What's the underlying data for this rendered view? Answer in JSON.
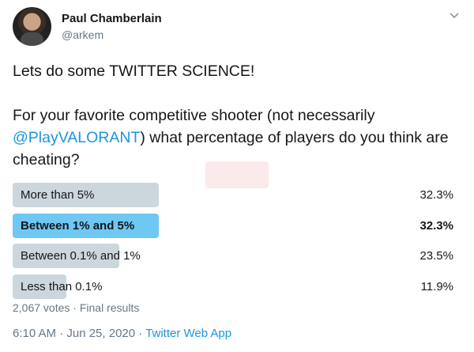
{
  "tweet": {
    "author": {
      "name": "Paul Chamberlain",
      "handle": "@arkem"
    },
    "icons": {
      "avatar": "avatar-photo",
      "menu": "chevron-down-icon"
    },
    "text_line1": "Lets do some TWITTER SCIENCE!",
    "text_part1": "For your favorite competitive shooter (not necessarily ",
    "mention": "@PlayVALORANT",
    "text_part2": ") what percentage of players do you think are cheating?",
    "poll": {
      "options": [
        {
          "label": "More than 5%",
          "percent_text": "32.3%",
          "percent": 32.3,
          "winner": false
        },
        {
          "label": "Between 1% and 5%",
          "percent_text": "32.3%",
          "percent": 32.3,
          "winner": true
        },
        {
          "label": "Between 0.1% and 1%",
          "percent_text": "23.5%",
          "percent": 23.5,
          "winner": false
        },
        {
          "label": "Less than 0.1%",
          "percent_text": "11.9%",
          "percent": 11.9,
          "winner": false
        }
      ],
      "votes": "2,067 votes",
      "separator": " · ",
      "status": "Final results"
    },
    "timestamp": "6:10 AM · Jun 25, 2020",
    "footer_separator": " · ",
    "source": "Twitter Web App"
  },
  "colors": {
    "text": "#14171a",
    "secondary": "#657786",
    "link": "#1b95e0",
    "bar": "#ccd6dd",
    "bar_winner": "#6fc7f3"
  }
}
